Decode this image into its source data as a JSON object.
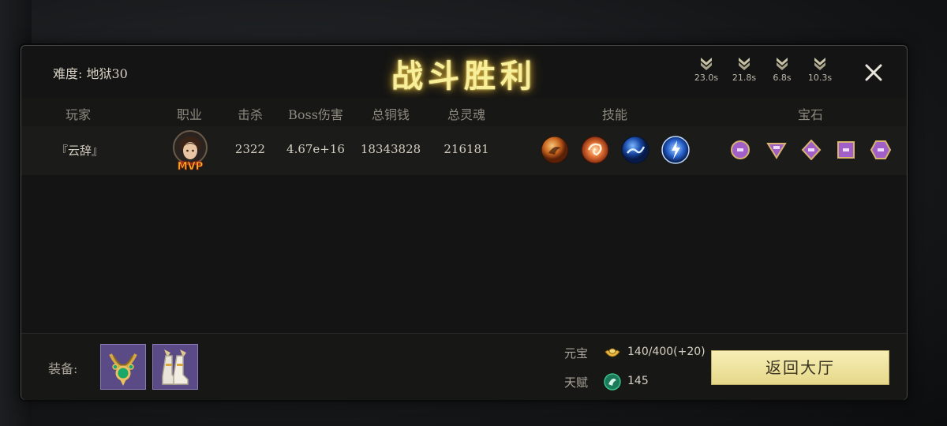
{
  "header": {
    "difficulty": "难度: 地狱30",
    "title": "战斗胜利",
    "timers": [
      "23.0s",
      "21.8s",
      "6.8s",
      "10.3s"
    ]
  },
  "columns": {
    "player": "玩家",
    "job": "职业",
    "kills": "击杀",
    "boss_damage": "Boss伤害",
    "total_copper": "总铜钱",
    "total_soul": "总灵魂",
    "skills": "技能",
    "gems": "宝石"
  },
  "row": {
    "player": "『云辞』",
    "badge": "MVP",
    "kills": "2322",
    "boss_damage": "4.67e+16",
    "total_copper": "18343828",
    "total_soul": "216181",
    "skills": [
      "fire-orb-icon",
      "flame-swirl-icon",
      "water-wave-icon",
      "lightning-orb-icon"
    ],
    "gems": [
      "circle-gem-icon",
      "triangle-gem-icon",
      "diamond-gem-icon",
      "square-gem-icon",
      "hexagon-gem-icon"
    ]
  },
  "footer": {
    "equip_label": "装备:",
    "equipment": [
      "emerald-necklace-icon",
      "winged-boots-icon"
    ],
    "yuanbao_label": "元宝",
    "yuanbao_value": "140/400(+20)",
    "talent_label": "天赋",
    "talent_value": "145",
    "back_button": "返回大厅"
  },
  "colors": {
    "title_glow": "#f7ef9a",
    "button_bg": "#f0e6a4",
    "gem_purple": "#a060c8",
    "gem_gold": "#d8b470"
  }
}
